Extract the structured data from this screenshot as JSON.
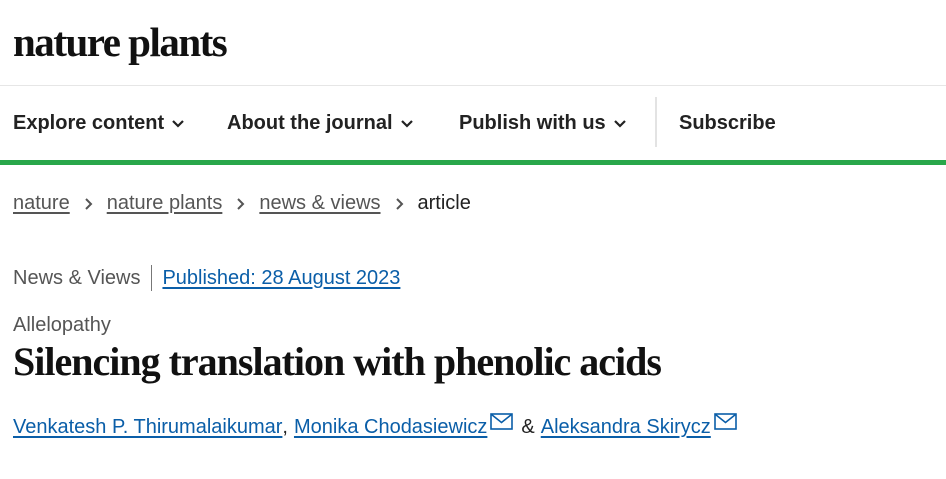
{
  "header": {
    "logo": "nature plants"
  },
  "nav": {
    "items": [
      {
        "label": "Explore content",
        "icon": "chevron-down-icon"
      },
      {
        "label": "About the journal",
        "icon": "chevron-down-icon"
      },
      {
        "label": "Publish with us",
        "icon": "chevron-down-icon"
      }
    ],
    "subscribe": "Subscribe"
  },
  "colors": {
    "accent_bar": "#29a74a",
    "link": "#0a5ea8"
  },
  "breadcrumb": {
    "items": [
      "nature",
      "nature plants",
      "news & views"
    ],
    "current": "article"
  },
  "article": {
    "type": "News & Views",
    "published": "Published: 28 August 2023",
    "subject": "Allelopathy",
    "title": "Silencing translation with phenolic acids",
    "authors": [
      {
        "name": "Venkatesh P. Thirumalaikumar",
        "email_icon": false
      },
      {
        "name": "Monika Chodasiewicz",
        "email_icon": true
      },
      {
        "name": "Aleksandra Skirycz",
        "email_icon": true
      }
    ],
    "author_sep_comma": ",",
    "author_sep_and": "&"
  }
}
